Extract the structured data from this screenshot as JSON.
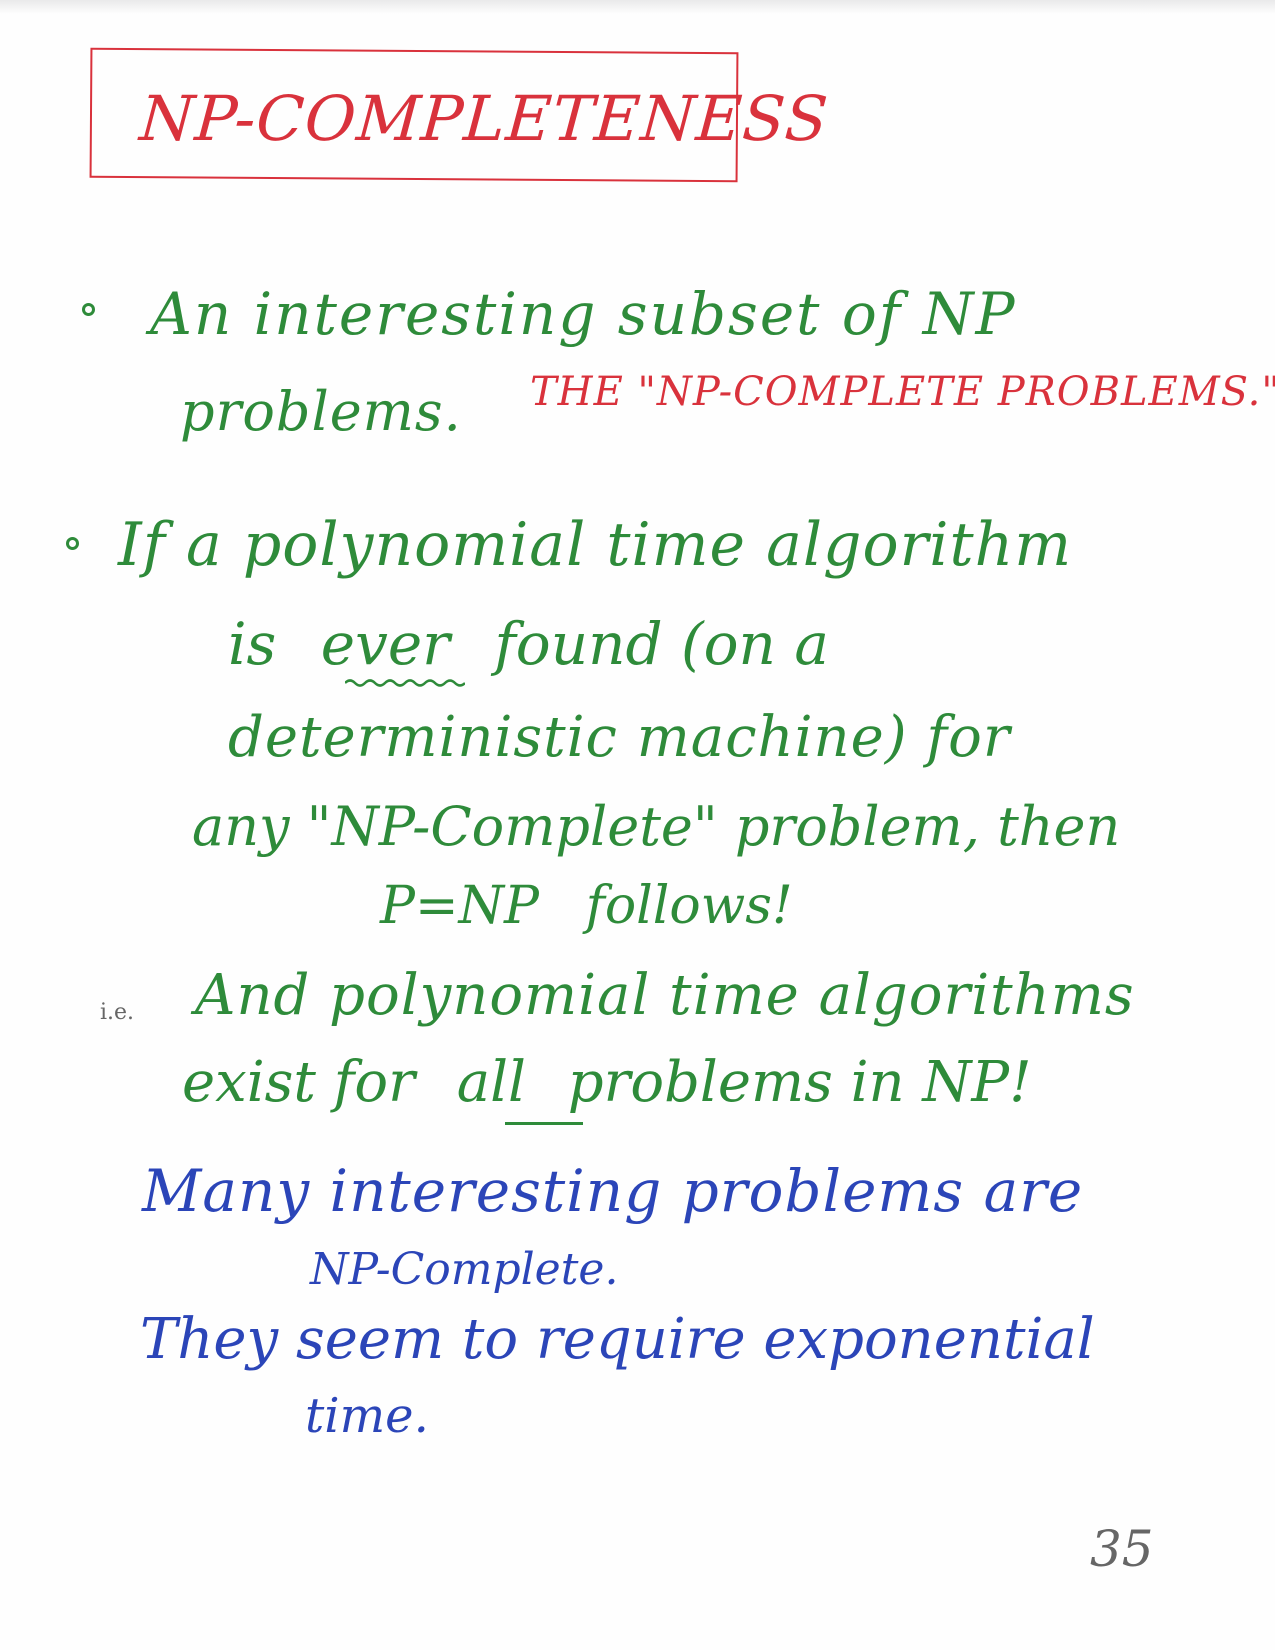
{
  "colors": {
    "green": "#2e8b3a",
    "red": "#d9323c",
    "blue": "#2b45b8",
    "gray": "#666666"
  },
  "title": "NP-COMPLETENESS",
  "bullet1": {
    "line1": "An interesting subset of NP",
    "line2": "problems.",
    "annotation": "THE \"NP-COMPLETE PROBLEMS.\""
  },
  "bullet2": {
    "line1": "If a polynomial time algorithm",
    "line2_pre": "is",
    "line2_emph": "ever",
    "line2_post": "found (on a",
    "line3": "deterministic machine) for",
    "line4": "any \"NP-Complete\" problem, then",
    "line5": "P=NP follows!"
  },
  "consequence": {
    "marker": "i.e.",
    "line1": "And polynomial time algorithms",
    "line2_pre": "exist for",
    "line2_emph": "all",
    "line2_post": "problems in NP!"
  },
  "remark": {
    "line1": "Many interesting problems are",
    "line2": "NP-Complete.",
    "line3": "They seem to require exponential",
    "line4": "time."
  },
  "page_number": "35"
}
